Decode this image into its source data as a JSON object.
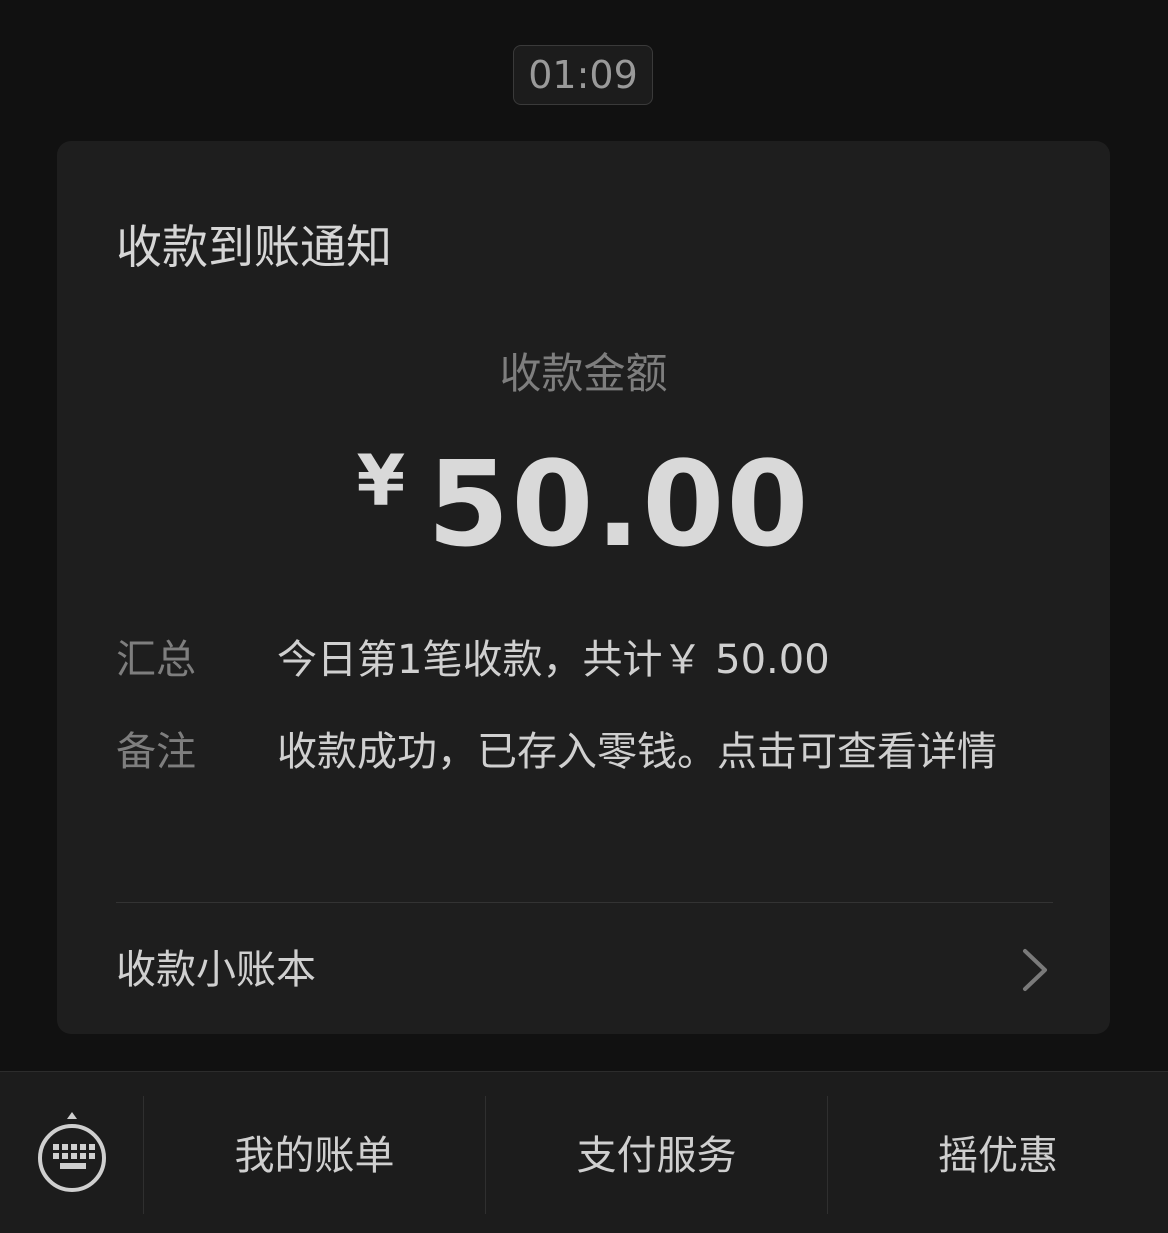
{
  "time": "01:09",
  "card": {
    "title": "收款到账通知",
    "amount_label": "收款金额",
    "currency_symbol": "¥",
    "amount": "50.00",
    "summary": {
      "key": "汇总",
      "value": "今日第1笔收款，共计￥ 50.00"
    },
    "remark": {
      "key": "备注",
      "value": "收款成功，已存入零钱。点击可查看详情"
    },
    "ledger_link": "收款小账本"
  },
  "bottom_menu": {
    "items": [
      {
        "label": "我的账单"
      },
      {
        "label": "支付服务"
      },
      {
        "label": "摇优惠"
      }
    ]
  },
  "icons": {
    "keyboard": "keyboard-icon",
    "chevron": "chevron-right-icon"
  },
  "colors": {
    "background": "#111111",
    "card": "#1e1e1e",
    "primary_text": "#d0d0d0",
    "secondary_text": "#7e7e7e"
  }
}
